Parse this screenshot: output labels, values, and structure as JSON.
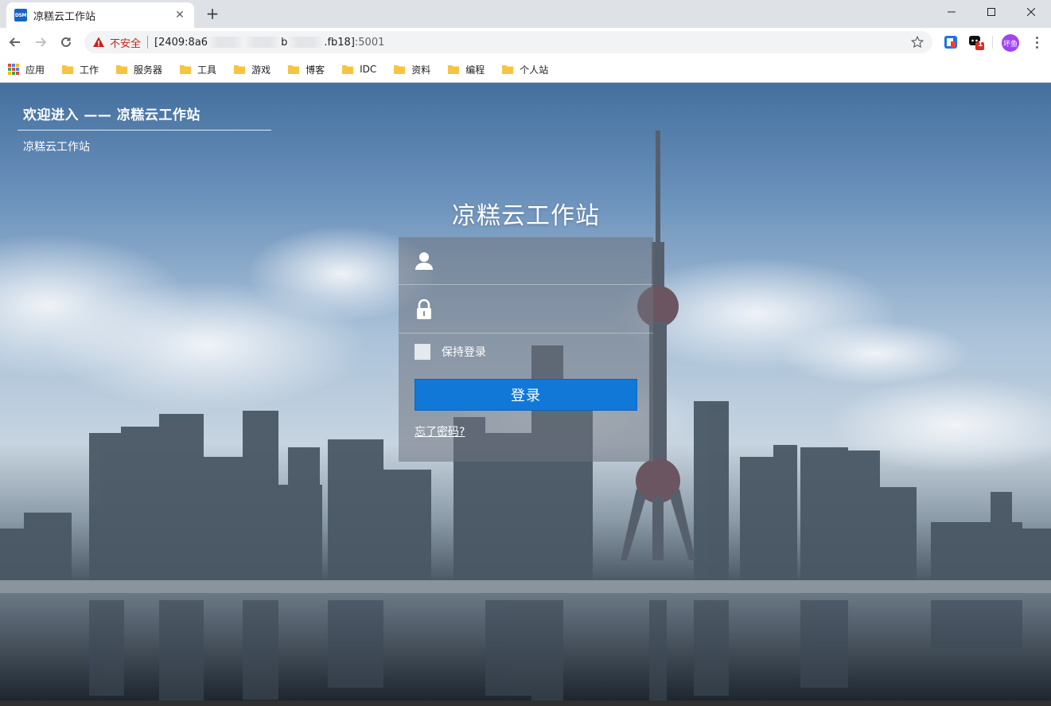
{
  "browser": {
    "tab": {
      "title": "凉糕云工作站",
      "favicon_text": "DSM",
      "favicon_color": "#1466c6"
    },
    "new_tab_label": "+",
    "window_controls": [
      "minimize-icon",
      "maximize-icon",
      "close-icon"
    ],
    "address": {
      "security_label": "不安全",
      "url_start": "[2409:8a6",
      "url_mid": "b",
      "url_end": ".fb18]",
      "url_port": ":5001"
    },
    "profile_badge": "坏鱼",
    "extension_badge": "1"
  },
  "bookmarks": {
    "apps_label": "应用",
    "items": [
      "工作",
      "服务器",
      "工具",
      "游戏",
      "博客",
      "IDC",
      "资料",
      "编程",
      "个人站"
    ]
  },
  "page": {
    "welcome_title": "欢迎进入 —— 凉糕云工作站",
    "welcome_subtitle": "凉糕云工作站",
    "site_title": "凉糕云工作站",
    "login": {
      "username_value": "",
      "password_value": "",
      "remember_label": "保持登录",
      "submit_label": "登录",
      "forgot_label": "忘了密码?"
    }
  },
  "colors": {
    "accent": "#1178d8",
    "insecure": "#c5221f",
    "avatar": "#a142f4"
  }
}
